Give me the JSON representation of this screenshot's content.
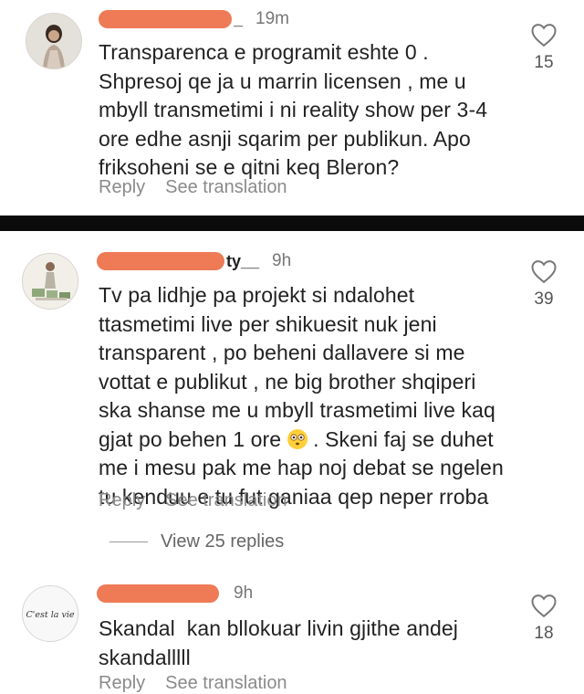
{
  "comments": [
    {
      "username_tail": "_",
      "time": "19m",
      "text": "Transparenca e programit eshte 0 .\nShpresoj qe ja u marrin licensen , me u\nmbyll transmetimi i ni reality show per 3-4\nore edhe asnji sqarim per publikun. Apo\nfriksoheni se e qitni keq Bleron?",
      "likes": "15",
      "reply": "Reply",
      "see_translation": "See translation"
    },
    {
      "username_tail": "ty__",
      "time": "9h",
      "text_before_emoji": "Tv pa lidhje pa projekt si ndalohet\nttasmetimi live per shikuesit nuk jeni\ntransparent , po beheni dallavere si me\nvottat e publikut , ne big brother shqiperi\nska shanse me u mbyll trasmetimi live kaq\ngjat po behen 1 ore ",
      "text_after_emoji": " . Skeni faj se duhet\nme i mesu pak me hap noj debat se ngelen\ntu kenduu e tu fut ganiaa qep neper rroba",
      "likes": "39",
      "reply": "Reply",
      "see_translation": "See translation",
      "view_replies": "View 25 replies"
    },
    {
      "username_tail": "",
      "time": "9h",
      "avatar_text": "C'est la vie",
      "text": "Skandal  kan bllokuar livin gjithe andej\nskandalllll",
      "likes": "18",
      "reply": "Reply",
      "see_translation": "See translation"
    }
  ],
  "colors": {
    "redaction": "#ee7a56",
    "divider": "#0b0b0b",
    "meta_gray": "#8a8a8a"
  },
  "icons": [
    "heart-icon",
    "flushed-face-emoji"
  ]
}
